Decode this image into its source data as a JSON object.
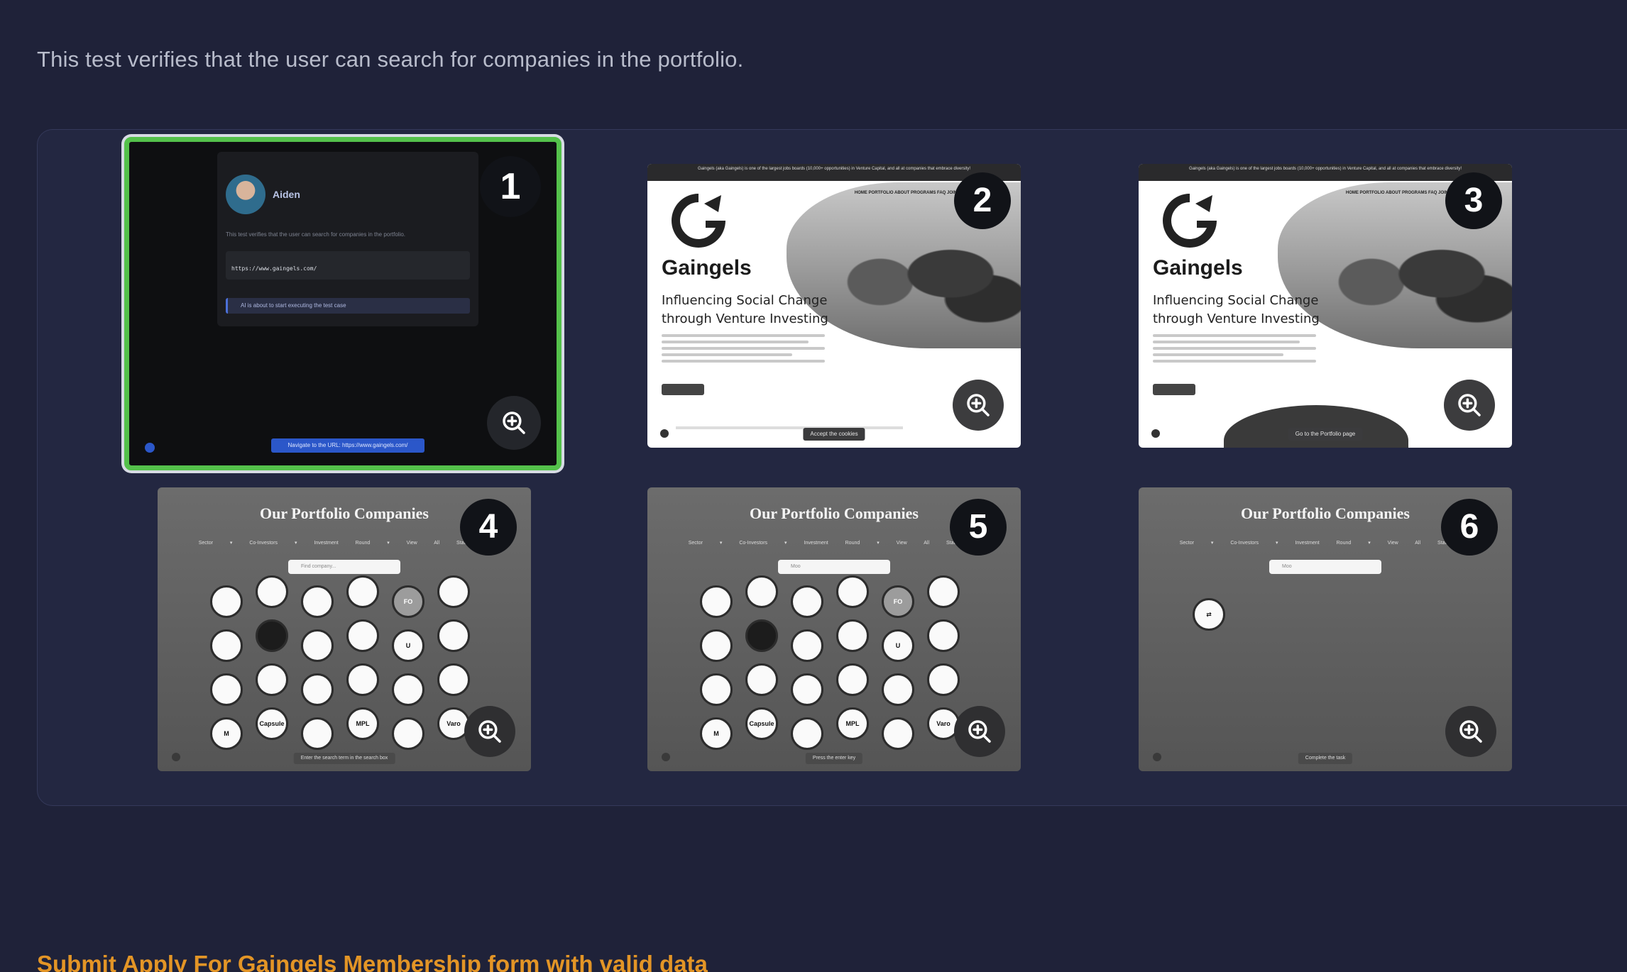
{
  "description": "This test verifies that the user can search for companies in the portfolio.",
  "next_test_title": "Submit Apply For Gaingels Membership form with valid data",
  "steps": [
    {
      "number": "1",
      "selected": true,
      "screen": {
        "user_name": "Aiden",
        "body_text": "This test verifies that the user can search for companies in the portfolio.",
        "url_value": "https://www.gaingels.com/",
        "alert_text": "AI is about to start executing the test case",
        "caption": "Navigate to the URL: https://www.gaingels.com/"
      }
    },
    {
      "number": "2",
      "screen": {
        "topbar": "Gaingels (aka Gaingels) is one of the largest jobs boards (10,000+ opportunities) in Venture Capital, and all at companies that embrace diversity!",
        "nav": "HOME  PORTFOLIO  ABOUT  PROGRAMS  FAQ  JOIN",
        "brand": "Gaingels",
        "subtitle_1": "Influencing Social Change",
        "subtitle_2": "through Venture Investing",
        "caption": "Accept the cookies"
      }
    },
    {
      "number": "3",
      "screen": {
        "topbar": "Gaingels (aka Gaingels) is one of the largest jobs boards (10,000+ opportunities) in Venture Capital, and all at companies that embrace diversity!",
        "nav": "HOME  PORTFOLIO  ABOUT  PROGRAMS  FAQ  JOIN",
        "brand": "Gaingels",
        "subtitle_1": "Influencing Social Change",
        "subtitle_2": "through Venture Investing",
        "caption": "Go to the Portfolio page"
      }
    },
    {
      "number": "4",
      "screen": {
        "title": "Our Portfolio Companies",
        "filters": "Sector ▾  Co-Investors ▾  Investment Round ▾  View All Status ▾",
        "search": "Find company...",
        "caption": "Enter the search term in the search box"
      }
    },
    {
      "number": "5",
      "screen": {
        "title": "Our Portfolio Companies",
        "filters": "Sector ▾  Co-Investors ▾  Investment Round ▾  View All Status ▾",
        "search": "Moo",
        "caption": "Press the enter key"
      }
    },
    {
      "number": "6",
      "screen": {
        "title": "Our Portfolio Companies",
        "filters": "Sector ▾  Co-Investors ▾  Investment Round ▾  View All Status ▾",
        "search": "Moo",
        "caption": "Complete the task"
      }
    }
  ],
  "logo_labels": [
    "",
    "",
    "",
    "",
    "FO",
    "",
    "",
    "",
    "",
    "",
    "U",
    "",
    "",
    "",
    "",
    "",
    "",
    "",
    "M",
    "Capsule",
    "",
    "MPL",
    "",
    "Varo"
  ],
  "colors": {
    "background": "#1f2239",
    "panel": "#232741",
    "selected_border": "#54c14b",
    "next_title": "#e39526"
  }
}
